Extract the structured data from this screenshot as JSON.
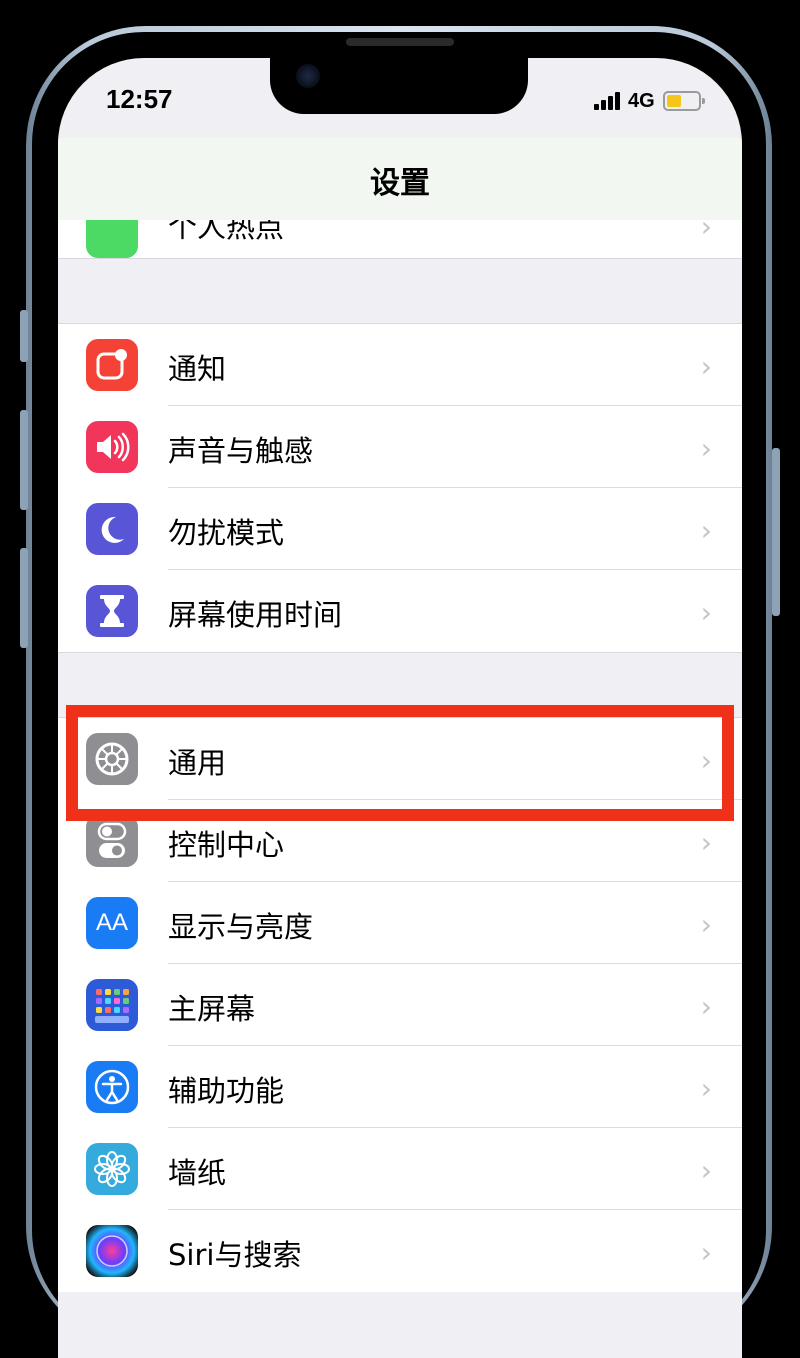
{
  "status_bar": {
    "time": "12:57",
    "network": "4G"
  },
  "nav": {
    "title": "设置"
  },
  "partial_item": {
    "label": "个人热点",
    "chevron": "›",
    "icon": "hotspot-icon",
    "color": "#4cd964"
  },
  "group1": [
    {
      "label": "通知",
      "chevron": "›",
      "icon": "notifications-icon",
      "color": "#f44336"
    },
    {
      "label": "声音与触感",
      "chevron": "›",
      "icon": "speaker-icon",
      "color": "#f2355b"
    },
    {
      "label": "勿扰模式",
      "chevron": "›",
      "icon": "moon-icon",
      "color": "#5856d6"
    },
    {
      "label": "屏幕使用时间",
      "chevron": "›",
      "icon": "hourglass-icon",
      "color": "#5856d6"
    }
  ],
  "group2": [
    {
      "label": "通用",
      "chevron": "›",
      "icon": "gear-icon",
      "color": "#8e8e93"
    },
    {
      "label": "控制中心",
      "chevron": "›",
      "icon": "toggles-icon",
      "color": "#8e8e93"
    },
    {
      "label": "显示与亮度",
      "chevron": "›",
      "icon": "text-size-icon",
      "color": "#1a7cf5"
    },
    {
      "label": "主屏幕",
      "chevron": "›",
      "icon": "home-screen-icon",
      "color": "#2d5bd8"
    },
    {
      "label": "辅助功能",
      "chevron": "›",
      "icon": "accessibility-icon",
      "color": "#1a7cf5"
    },
    {
      "label": "墙纸",
      "chevron": "›",
      "icon": "wallpaper-flower-icon",
      "color": "#35aadc"
    },
    {
      "label": "Siri与搜索",
      "chevron": "›",
      "icon": "siri-icon",
      "color": "#222244"
    }
  ],
  "display_icon_text": "AA",
  "highlight": {
    "target": "通用",
    "color": "#f0311a"
  }
}
